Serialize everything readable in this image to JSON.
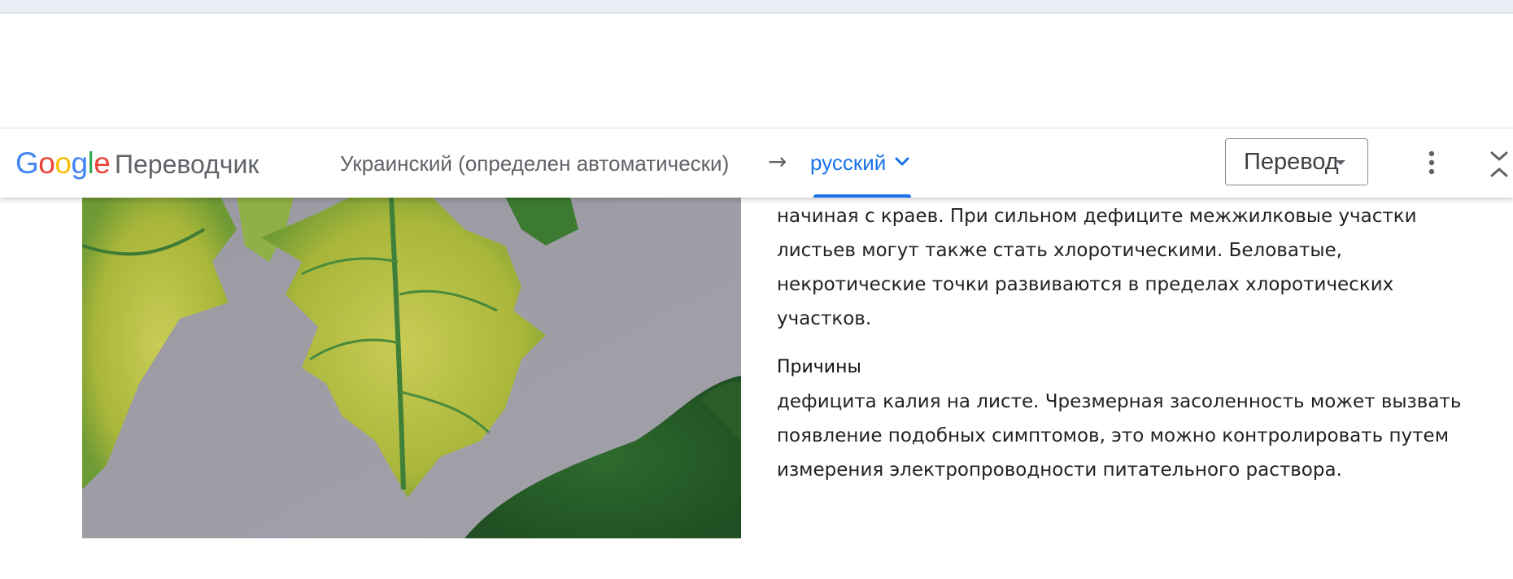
{
  "translate_bar": {
    "logo": {
      "letters": [
        "G",
        "o",
        "o",
        "g",
        "l",
        "e"
      ]
    },
    "product_name": "Переводчик",
    "source_language": "Украинский (определен автоматически)",
    "arrow": "→",
    "target_language": "русский",
    "mode_select": {
      "value": "Перевод"
    },
    "icons": {
      "target_dropdown": "chevron-down-icon",
      "more": "more-vert-icon",
      "close": "collapse-icon"
    }
  },
  "article": {
    "paragraph_1_lines": [
      "начиная с краев. При сильном дефиците межжилковые участки",
      "листьев могут также стать хлоротическими. Беловатые,",
      "некротические точки развиваются в пределах хлоротических",
      "участков."
    ],
    "section_heading": "Причины",
    "paragraph_2_lines": [
      "дефицита калия на листе. Чрезмерная засоленность может вызвать",
      "появление подобных симптомов, это можно контролировать путем",
      "измерения электропроводности питательного раствора."
    ]
  },
  "colors": {
    "accent": "#1a73e8",
    "google_blue": "#4285f4",
    "google_red": "#ea4335",
    "google_yellow": "#fbbc05",
    "google_green": "#34a853"
  }
}
